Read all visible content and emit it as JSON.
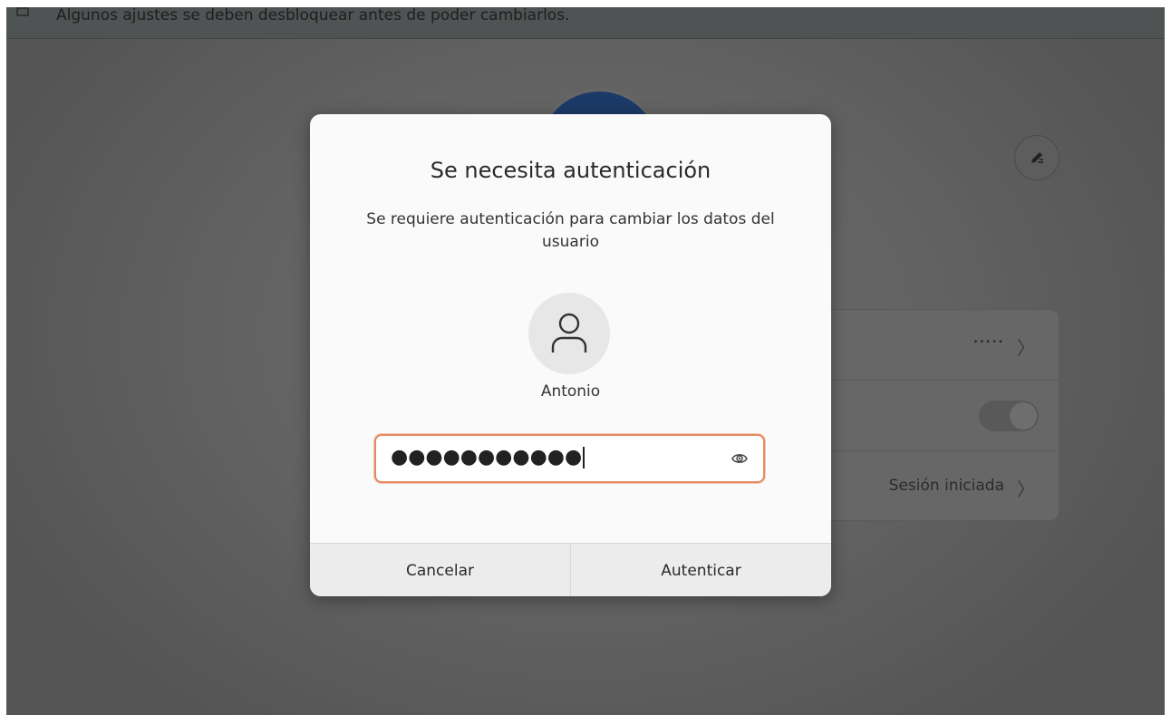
{
  "banner": {
    "text": "Algunos ajustes se deben desbloquear antes de poder cambiarlos.",
    "icon": "lock-icon"
  },
  "background": {
    "rows": [
      {
        "value": "•••••"
      },
      {
        "toggle": "off"
      },
      {
        "value": "Sesión iniciada"
      }
    ]
  },
  "dialog": {
    "title": "Se necesita autenticación",
    "message": "Se requiere autenticación para cambiar los datos del usuario",
    "user_name": "Antonio",
    "password_masked": "●●●●●●●●●●●",
    "buttons": {
      "cancel": "Cancelar",
      "authenticate": "Autenticar"
    }
  },
  "colors": {
    "focus_border": "#e48a62",
    "dialog_bg": "#fafafa",
    "button_bg": "#ececec"
  }
}
